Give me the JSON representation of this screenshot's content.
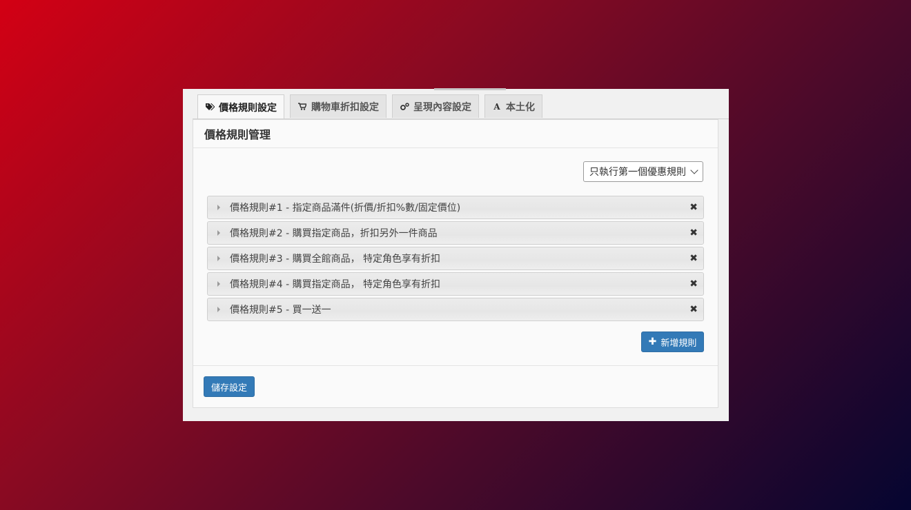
{
  "tabs": [
    {
      "label": "價格規則設定",
      "icon": "tags-icon"
    },
    {
      "label": "購物車折扣設定",
      "icon": "cart-icon"
    },
    {
      "label": "呈現內容設定",
      "icon": "gears-icon"
    },
    {
      "label": "本土化",
      "icon": "font-icon"
    }
  ],
  "panel": {
    "title": "價格規則管理"
  },
  "select": {
    "value": "只執行第一個優惠規則"
  },
  "rules": [
    {
      "label": "價格規則#1 - 指定商品滿件(折價/折扣%數/固定價位)"
    },
    {
      "label": "價格規則#2 - 購買指定商品，折扣另外一件商品"
    },
    {
      "label": "價格規則#3 - 購買全館商品， 特定角色享有折扣"
    },
    {
      "label": "價格規則#4 - 購買指定商品， 特定角色享有折扣"
    },
    {
      "label": "價格規則#5 - 買一送一"
    }
  ],
  "buttons": {
    "add_rule": "新增規則",
    "save": "儲存設定"
  },
  "colors": {
    "primary": "#337ab7"
  }
}
